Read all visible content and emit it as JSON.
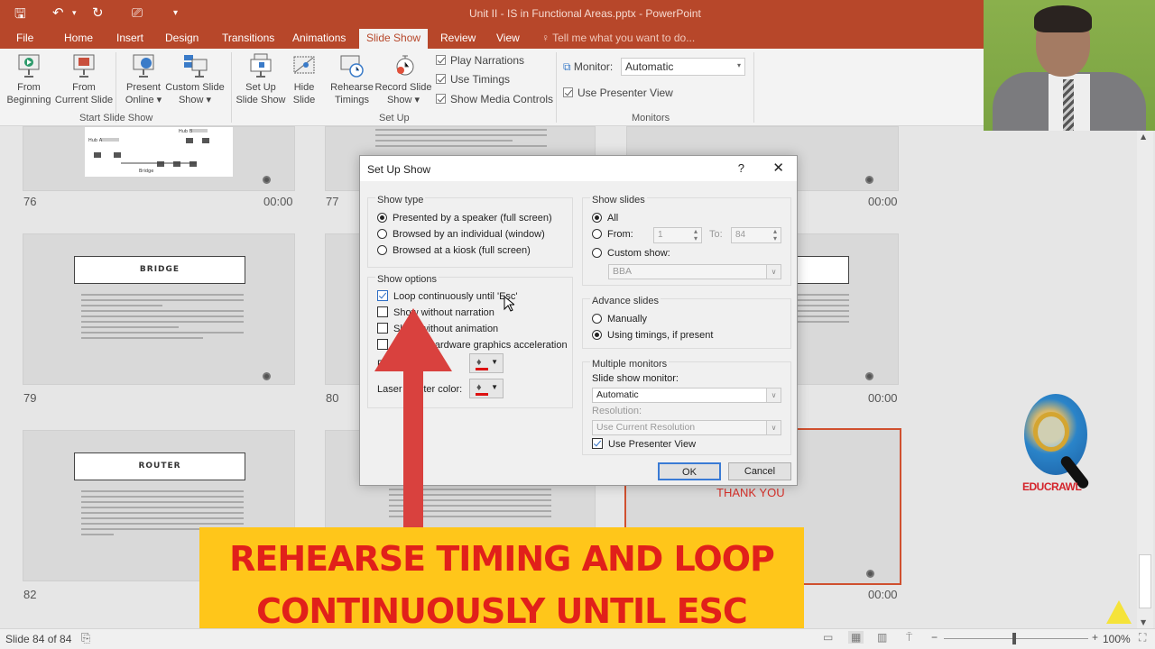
{
  "window": {
    "title": "Unit II - IS in Functional Areas.pptx - PowerPoint"
  },
  "quick_access": {
    "icons": [
      "save-icon",
      "undo-icon",
      "redo-icon",
      "presentation-icon",
      "customize-icon"
    ]
  },
  "tabs": [
    {
      "label": "File"
    },
    {
      "label": "Home"
    },
    {
      "label": "Insert"
    },
    {
      "label": "Design"
    },
    {
      "label": "Transitions"
    },
    {
      "label": "Animations"
    },
    {
      "label": "Slide Show",
      "active": true
    },
    {
      "label": "Review"
    },
    {
      "label": "View"
    }
  ],
  "tell_me": "Tell me what you want to do...",
  "ribbon": {
    "start_group": {
      "label": "Start Slide Show",
      "buttons": [
        {
          "line1": "From",
          "line2": "Beginning"
        },
        {
          "line1": "From",
          "line2": "Current Slide"
        },
        {
          "line1": "Present",
          "line2": "Online ▾"
        },
        {
          "line1": "Custom Slide",
          "line2": "Show ▾"
        }
      ]
    },
    "setup_group": {
      "label": "Set Up",
      "buttons": [
        {
          "line1": "Set Up",
          "line2": "Slide Show"
        },
        {
          "line1": "Hide",
          "line2": "Slide"
        },
        {
          "line1": "Rehearse",
          "line2": "Timings"
        },
        {
          "line1": "Record Slide",
          "line2": "Show ▾"
        }
      ],
      "checks": [
        {
          "label": "Play Narrations",
          "checked": true
        },
        {
          "label": "Use Timings",
          "checked": true
        },
        {
          "label": "Show Media Controls",
          "checked": true
        }
      ]
    },
    "monitors_group": {
      "label": "Monitors",
      "monitor_label": "Monitor:",
      "monitor_value": "Automatic",
      "presenter_view": "Use Presenter View"
    }
  },
  "slides": [
    {
      "number": "76",
      "time": "00:00"
    },
    {
      "number": "77",
      "time": ""
    },
    {
      "number": "",
      "time": "00:00"
    },
    {
      "number": "79",
      "time": "",
      "title": "BRIDGE"
    },
    {
      "number": "80",
      "time": ""
    },
    {
      "number": "",
      "time": "00:00"
    },
    {
      "number": "82",
      "time": "",
      "title": "ROUTER"
    },
    {
      "number": "",
      "time": ""
    },
    {
      "number": "",
      "time": "00:00",
      "title": "THANK YOU"
    }
  ],
  "dialog": {
    "title": "Set Up Show",
    "help": "?",
    "close": "✕",
    "show_type": {
      "legend": "Show type",
      "options": [
        {
          "label": "Presented by a speaker (full screen)",
          "selected": true
        },
        {
          "label": "Browsed by an individual (window)",
          "selected": false
        },
        {
          "label": "Browsed at a kiosk (full screen)",
          "selected": false
        }
      ]
    },
    "show_options": {
      "legend": "Show options",
      "options": [
        {
          "label": "Loop continuously until 'Esc'",
          "checked": true
        },
        {
          "label": "Show without narration",
          "checked": false
        },
        {
          "label": "Show without animation",
          "checked": false
        },
        {
          "label": "Disable hardware graphics acceleration",
          "checked": false
        }
      ],
      "pen_color_label": "Pen color:",
      "laser_color_label": "Laser pointer color:",
      "pen_color": "#dd1111",
      "laser_color": "#dd1111"
    },
    "show_slides": {
      "legend": "Show slides",
      "all": "All",
      "from": "From:",
      "from_value": "1",
      "to": "To:",
      "to_value": "84",
      "custom": "Custom show:",
      "custom_value": "BBA"
    },
    "advance": {
      "legend": "Advance slides",
      "manually": "Manually",
      "timings": "Using timings, if present"
    },
    "monitors": {
      "legend": "Multiple monitors",
      "monitor_label": "Slide show monitor:",
      "monitor_value": "Automatic",
      "resolution_label": "Resolution:",
      "resolution_value": "Use Current Resolution",
      "presenter_view": "Use Presenter View",
      "presenter_checked": true
    },
    "ok": "OK",
    "cancel": "Cancel"
  },
  "banner": {
    "line1": "REHEARSE TIMING AND LOOP",
    "line2": "CONTINUOUSLY UNTIL ESC"
  },
  "logo": {
    "text": "EDUCRAWL"
  },
  "status": {
    "slide": "Slide 84 of 84",
    "zoom": "100%"
  }
}
